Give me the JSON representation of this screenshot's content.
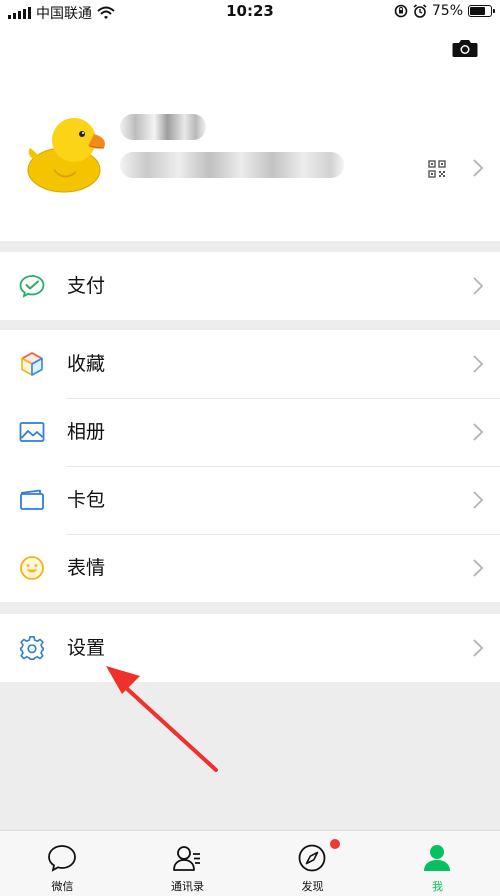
{
  "status_bar": {
    "carrier": "中国联通",
    "time": "10:23",
    "battery_text": "75%",
    "battery_level": 0.75
  },
  "profile": {
    "avatar_icon": "duck-avatar",
    "camera_icon": "camera-icon",
    "qr_icon": "qr-code-icon"
  },
  "menu": {
    "pay": {
      "label": "支付",
      "icon": "wechat-pay-icon"
    },
    "favorites": {
      "label": "收藏",
      "icon": "cube-icon"
    },
    "album": {
      "label": "相册",
      "icon": "image-icon"
    },
    "cards": {
      "label": "卡包",
      "icon": "card-icon"
    },
    "stickers": {
      "label": "表情",
      "icon": "smile-icon"
    },
    "settings": {
      "label": "设置",
      "icon": "gear-icon"
    }
  },
  "tab_bar": {
    "tabs": [
      {
        "label": "微信",
        "icon": "chat-bubble-icon",
        "active": false
      },
      {
        "label": "通讯录",
        "icon": "contacts-icon",
        "active": false
      },
      {
        "label": "发现",
        "icon": "compass-icon",
        "active": false,
        "badge": true
      },
      {
        "label": "我",
        "icon": "person-icon",
        "active": true
      }
    ]
  },
  "colors": {
    "accent_green": "#07c160",
    "arrow_red": "#f0302a",
    "badge_red": "#f43530",
    "background": "#ededed"
  }
}
